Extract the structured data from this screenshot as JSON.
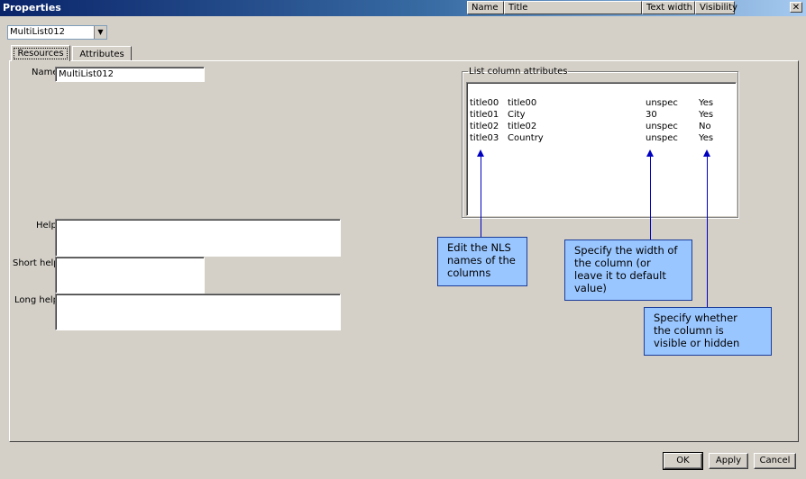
{
  "window": {
    "title": "Properties",
    "close_glyph": "✕"
  },
  "object_selector": {
    "value": "MultiList012",
    "arrow_glyph": "▼"
  },
  "tabs": [
    {
      "label": "Resources",
      "active": true
    },
    {
      "label": "Attributes",
      "active": false
    }
  ],
  "form": {
    "name_label": "Name",
    "name_value": "MultiList012",
    "help_label": "Help",
    "help_value": "",
    "short_help_label": "Short help",
    "short_help_value": "",
    "long_help_label": "Long help",
    "long_help_value": ""
  },
  "columns_group": {
    "legend": "List column attributes",
    "headers": [
      "Name",
      "Title",
      "Text width",
      "Visibility"
    ],
    "rows": [
      [
        "title00",
        "title00",
        "unspec",
        "Yes"
      ],
      [
        "title01",
        "City",
        "30",
        "Yes"
      ],
      [
        "title02",
        "title02",
        "unspec",
        "No"
      ],
      [
        "title03",
        "Country",
        "unspec",
        "Yes"
      ]
    ]
  },
  "callouts": {
    "nls": "Edit the NLS\nnames of the\ncolumns",
    "width": "Specify the width of\nthe column (or\nleave it to default\nvalue)",
    "visibility": "Specify whether\nthe column is\nvisible or hidden"
  },
  "buttons": {
    "ok": "OK",
    "apply": "Apply",
    "cancel": "Cancel"
  },
  "colors": {
    "titlebar_start": "#0a246a",
    "dialog_bg": "#d4d0c8",
    "callout_bg": "#9ac6ff",
    "arrow": "#0000c0"
  }
}
